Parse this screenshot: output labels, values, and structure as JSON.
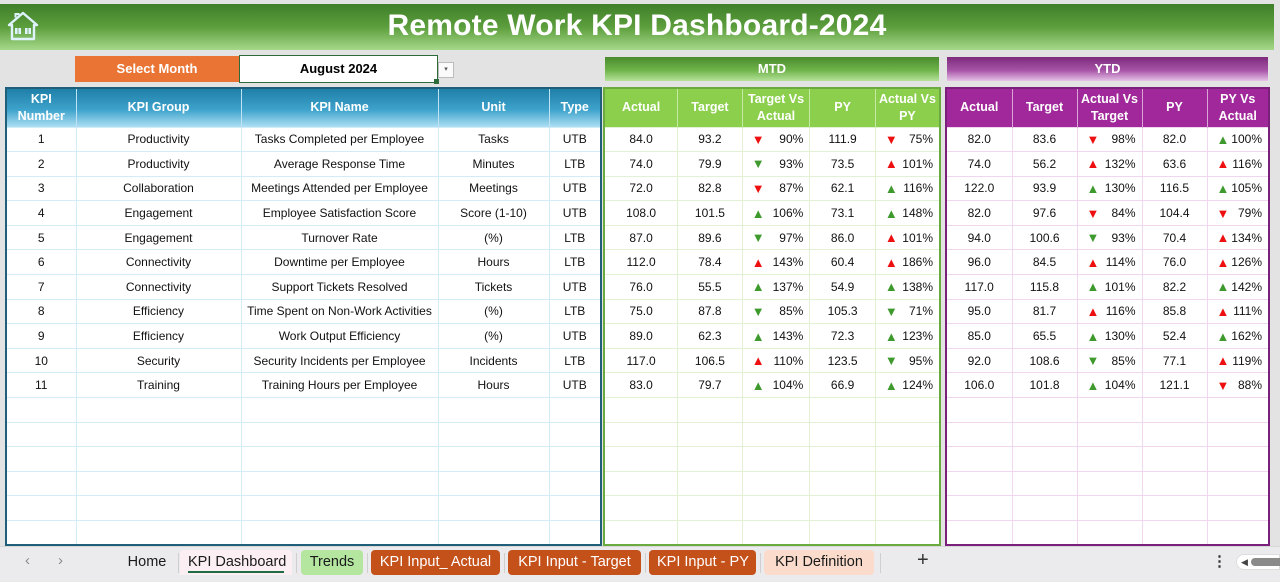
{
  "header": {
    "title": "Remote Work KPI Dashboard-2024",
    "home_icon": "home-icon"
  },
  "selector": {
    "label": "Select Month",
    "value": "August 2024",
    "dropdown_icon": "▾"
  },
  "bands": {
    "mtd": "MTD",
    "ytd": "YTD"
  },
  "info_columns": [
    "KPI Number",
    "KPI Group",
    "KPI Name",
    "Unit",
    "Type"
  ],
  "mtd_columns": [
    "Actual",
    "Target",
    "Target Vs Actual",
    "PY",
    "Actual Vs PY"
  ],
  "ytd_columns": [
    "Actual",
    "Target",
    "Actual Vs Target",
    "PY",
    "PY Vs Actual"
  ],
  "colors": {
    "up_green": "#3e9a2d",
    "down_red": "#ee1010",
    "info_header": "#1f7fa8",
    "mtd_header": "#8ccf4d",
    "ytd_header": "#a0289a",
    "select_label": "#ea7434"
  },
  "rows": [
    {
      "num": "1",
      "group": "Productivity",
      "name": "Tasks Completed per Employee",
      "unit": "Tasks",
      "type": "UTB",
      "mtd": {
        "actual": "84.0",
        "target": "93.2",
        "tva": "90%",
        "tva_icon": "down-red",
        "py": "111.9",
        "avp": "75%",
        "avp_icon": "down-red"
      },
      "ytd": {
        "actual": "82.0",
        "target": "83.6",
        "avt": "98%",
        "avt_icon": "down-red",
        "py": "82.0",
        "pva": "100%",
        "pva_icon": "up-green"
      }
    },
    {
      "num": "2",
      "group": "Productivity",
      "name": "Average Response Time",
      "unit": "Minutes",
      "type": "LTB",
      "mtd": {
        "actual": "74.0",
        "target": "79.9",
        "tva": "93%",
        "tva_icon": "down-green",
        "py": "73.5",
        "avp": "101%",
        "avp_icon": "up-red"
      },
      "ytd": {
        "actual": "74.0",
        "target": "56.2",
        "avt": "132%",
        "avt_icon": "up-red",
        "py": "63.6",
        "pva": "116%",
        "pva_icon": "up-red"
      }
    },
    {
      "num": "3",
      "group": "Collaboration",
      "name": "Meetings Attended per Employee",
      "unit": "Meetings",
      "type": "UTB",
      "mtd": {
        "actual": "72.0",
        "target": "82.8",
        "tva": "87%",
        "tva_icon": "down-red",
        "py": "62.1",
        "avp": "116%",
        "avp_icon": "up-green"
      },
      "ytd": {
        "actual": "122.0",
        "target": "93.9",
        "avt": "130%",
        "avt_icon": "up-green",
        "py": "116.5",
        "pva": "105%",
        "pva_icon": "up-green"
      }
    },
    {
      "num": "4",
      "group": "Engagement",
      "name": "Employee Satisfaction Score",
      "unit": "Score (1-10)",
      "type": "UTB",
      "mtd": {
        "actual": "108.0",
        "target": "101.5",
        "tva": "106%",
        "tva_icon": "up-green",
        "py": "73.1",
        "avp": "148%",
        "avp_icon": "up-green"
      },
      "ytd": {
        "actual": "82.0",
        "target": "97.6",
        "avt": "84%",
        "avt_icon": "down-red",
        "py": "104.4",
        "pva": "79%",
        "pva_icon": "down-red"
      }
    },
    {
      "num": "5",
      "group": "Engagement",
      "name": "Turnover Rate",
      "unit": "(%)",
      "type": "LTB",
      "mtd": {
        "actual": "87.0",
        "target": "89.6",
        "tva": "97%",
        "tva_icon": "down-green",
        "py": "86.0",
        "avp": "101%",
        "avp_icon": "up-red"
      },
      "ytd": {
        "actual": "94.0",
        "target": "100.6",
        "avt": "93%",
        "avt_icon": "down-green",
        "py": "70.4",
        "pva": "134%",
        "pva_icon": "up-red"
      }
    },
    {
      "num": "6",
      "group": "Connectivity",
      "name": "Downtime per Employee",
      "unit": "Hours",
      "type": "LTB",
      "mtd": {
        "actual": "112.0",
        "target": "78.4",
        "tva": "143%",
        "tva_icon": "up-red",
        "py": "60.4",
        "avp": "186%",
        "avp_icon": "up-red"
      },
      "ytd": {
        "actual": "96.0",
        "target": "84.5",
        "avt": "114%",
        "avt_icon": "up-red",
        "py": "76.0",
        "pva": "126%",
        "pva_icon": "up-red"
      }
    },
    {
      "num": "7",
      "group": "Connectivity",
      "name": "Support Tickets Resolved",
      "unit": "Tickets",
      "type": "UTB",
      "mtd": {
        "actual": "76.0",
        "target": "55.5",
        "tva": "137%",
        "tva_icon": "up-green",
        "py": "54.9",
        "avp": "138%",
        "avp_icon": "up-green"
      },
      "ytd": {
        "actual": "117.0",
        "target": "115.8",
        "avt": "101%",
        "avt_icon": "up-green",
        "py": "82.2",
        "pva": "142%",
        "pva_icon": "up-green"
      }
    },
    {
      "num": "8",
      "group": "Efficiency",
      "name": "Time Spent on Non-Work Activities",
      "unit": "(%)",
      "type": "LTB",
      "mtd": {
        "actual": "75.0",
        "target": "87.8",
        "tva": "85%",
        "tva_icon": "down-green",
        "py": "105.3",
        "avp": "71%",
        "avp_icon": "down-green"
      },
      "ytd": {
        "actual": "95.0",
        "target": "81.7",
        "avt": "116%",
        "avt_icon": "up-red",
        "py": "85.8",
        "pva": "111%",
        "pva_icon": "up-red"
      }
    },
    {
      "num": "9",
      "group": "Efficiency",
      "name": "Work Output Efficiency",
      "unit": "(%)",
      "type": "UTB",
      "mtd": {
        "actual": "89.0",
        "target": "62.3",
        "tva": "143%",
        "tva_icon": "up-green",
        "py": "72.3",
        "avp": "123%",
        "avp_icon": "up-green"
      },
      "ytd": {
        "actual": "85.0",
        "target": "65.5",
        "avt": "130%",
        "avt_icon": "up-green",
        "py": "52.4",
        "pva": "162%",
        "pva_icon": "up-green"
      }
    },
    {
      "num": "10",
      "group": "Security",
      "name": "Security Incidents per Employee",
      "unit": "Incidents",
      "type": "LTB",
      "mtd": {
        "actual": "117.0",
        "target": "106.5",
        "tva": "110%",
        "tva_icon": "up-red",
        "py": "123.5",
        "avp": "95%",
        "avp_icon": "down-green"
      },
      "ytd": {
        "actual": "92.0",
        "target": "108.6",
        "avt": "85%",
        "avt_icon": "down-green",
        "py": "77.1",
        "pva": "119%",
        "pva_icon": "up-red"
      }
    },
    {
      "num": "11",
      "group": "Training",
      "name": "Training Hours per Employee",
      "unit": "Hours",
      "type": "UTB",
      "mtd": {
        "actual": "83.0",
        "target": "79.7",
        "tva": "104%",
        "tva_icon": "up-green",
        "py": "66.9",
        "avp": "124%",
        "avp_icon": "up-green"
      },
      "ytd": {
        "actual": "106.0",
        "target": "101.8",
        "avt": "104%",
        "avt_icon": "up-green",
        "py": "121.1",
        "pva": "88%",
        "pva_icon": "down-red"
      }
    }
  ],
  "empty_row_count": 6,
  "sheet_tabs": [
    {
      "label": "Home",
      "style": "plain"
    },
    {
      "label": "KPI Dashboard",
      "style": "active"
    },
    {
      "label": "Trends",
      "style": "green"
    },
    {
      "label": "KPI Input_ Actual",
      "style": "orange"
    },
    {
      "label": "KPI Input - Target",
      "style": "orange"
    },
    {
      "label": "KPI Input - PY",
      "style": "orange"
    },
    {
      "label": "KPI Definition",
      "style": "peach"
    }
  ],
  "sheetbar": {
    "prev": "‹",
    "next": "›",
    "add": "+",
    "more": "⋮",
    "scroll_left": "◀"
  }
}
